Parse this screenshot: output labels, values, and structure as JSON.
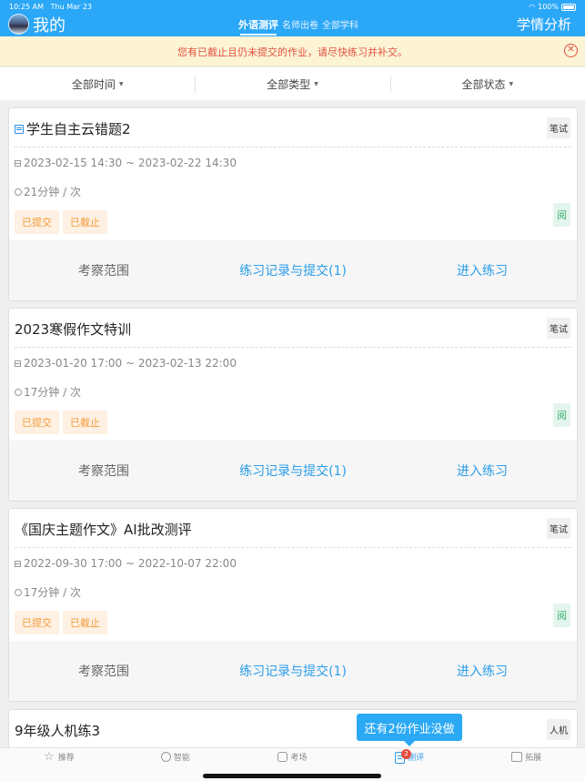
{
  "status": {
    "time": "10:25 AM",
    "date": "Thu Mar 23",
    "battery": "100%"
  },
  "header": {
    "title": "我的",
    "tabs": [
      {
        "label": "外语测评"
      },
      {
        "label": "名师出卷"
      },
      {
        "label": "全部学科"
      }
    ],
    "right_label": "学情分析"
  },
  "notice": {
    "text": "您有已截止且仍未提交的作业，请尽快练习并补交。"
  },
  "filters": [
    {
      "label": "全部时间"
    },
    {
      "label": "全部类型"
    },
    {
      "label": "全部状态"
    }
  ],
  "cards": [
    {
      "title": "学生自主云错题2",
      "type": "笔试",
      "date_range": "2023-02-15 14:30 ~ 2023-02-22 14:30",
      "duration": "21分钟 / 次",
      "tags": [
        "已提交",
        "已截止"
      ],
      "read": "阅",
      "actions": [
        "考察范围",
        "练习记录与提交(1)",
        "进入练习"
      ]
    },
    {
      "title": "2023寒假作文特训",
      "type": "笔试",
      "date_range": "2023-01-20 17:00 ~ 2023-02-13 22:00",
      "duration": "17分钟 / 次",
      "tags": [
        "已提交",
        "已截止"
      ],
      "read": "阅",
      "actions": [
        "考察范围",
        "练习记录与提交(1)",
        "进入练习"
      ]
    },
    {
      "title": "《国庆主题作文》AI批改测评",
      "type": "笔试",
      "date_range": "2022-09-30 17:00 ~ 2022-10-07 22:00",
      "duration": "17分钟 / 次",
      "tags": [
        "已提交",
        "已截止"
      ],
      "read": "阅",
      "actions": [
        "考察范围",
        "练习记录与提交(1)",
        "进入练习"
      ]
    },
    {
      "title": "9年级人机练3",
      "type": "人机"
    }
  ],
  "floating_tip": "还有2份作业没做",
  "tabbar": [
    {
      "label": "推荐"
    },
    {
      "label": "智能"
    },
    {
      "label": "考场"
    },
    {
      "label": "测评",
      "badge": "2"
    },
    {
      "label": "拓展"
    }
  ]
}
